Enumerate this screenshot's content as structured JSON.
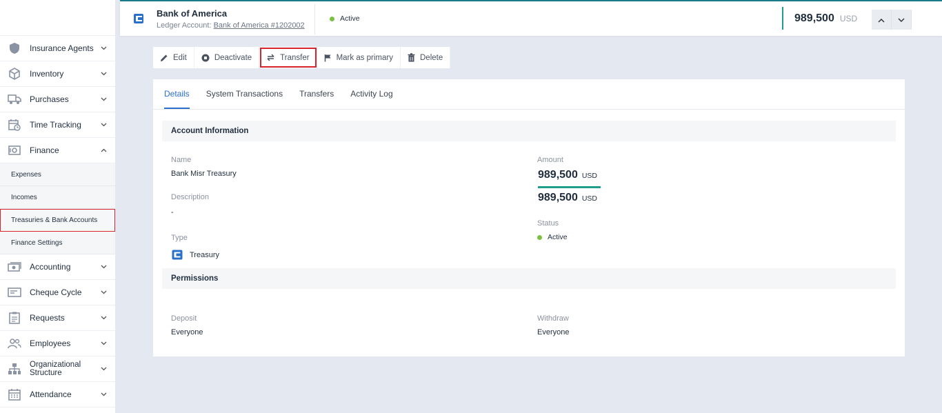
{
  "sidebar": {
    "items_top": [
      {
        "label": "Insurance Agents",
        "icon": "shield-icon"
      },
      {
        "label": "Inventory",
        "icon": "box-icon"
      },
      {
        "label": "Purchases",
        "icon": "truck-icon"
      },
      {
        "label": "Time Tracking",
        "icon": "calendar-clock-icon"
      },
      {
        "label": "Finance",
        "icon": "safe-icon"
      }
    ],
    "finance_sub": [
      {
        "label": "Expenses"
      },
      {
        "label": "Incomes"
      },
      {
        "label": "Treasuries & Bank Accounts"
      },
      {
        "label": "Finance Settings"
      }
    ],
    "items_bottom": [
      {
        "label": "Accounting",
        "icon": "money-icon"
      },
      {
        "label": "Cheque Cycle",
        "icon": "cheque-icon"
      },
      {
        "label": "Requests",
        "icon": "clipboard-icon"
      },
      {
        "label": "Employees",
        "icon": "users-icon"
      },
      {
        "label": "Organizational Structure",
        "icon": "org-chart-icon"
      },
      {
        "label": "Attendance",
        "icon": "calendar-icon"
      }
    ]
  },
  "header": {
    "title": "Bank of America",
    "ledger_label": "Ledger Account:",
    "ledger_link": "Bank of America #1202002",
    "status": "Active",
    "amount": "989,500",
    "currency": "USD"
  },
  "toolbar": {
    "edit": "Edit",
    "deactivate": "Deactivate",
    "transfer": "Transfer",
    "mark_primary": "Mark as primary",
    "delete": "Delete"
  },
  "tabs": [
    "Details",
    "System Transactions",
    "Transfers",
    "Activity Log"
  ],
  "account_info": {
    "title": "Account Information",
    "name_label": "Name",
    "name": "Bank Misr Treasury",
    "description_label": "Description",
    "description": "-",
    "type_label": "Type",
    "type": "Treasury",
    "amount_label": "Amount",
    "amount1": "989,500",
    "currency1": "USD",
    "amount2": "989,500",
    "currency2": "USD",
    "status_label": "Status",
    "status": "Active"
  },
  "permissions": {
    "title": "Permissions",
    "deposit_label": "Deposit",
    "deposit": "Everyone",
    "withdraw_label": "Withdraw",
    "withdraw": "Everyone"
  },
  "colors": {
    "accent": "#2a6fc9",
    "teal": "#1f9e8c",
    "active": "#7ac142",
    "highlight": "#d8232a"
  }
}
